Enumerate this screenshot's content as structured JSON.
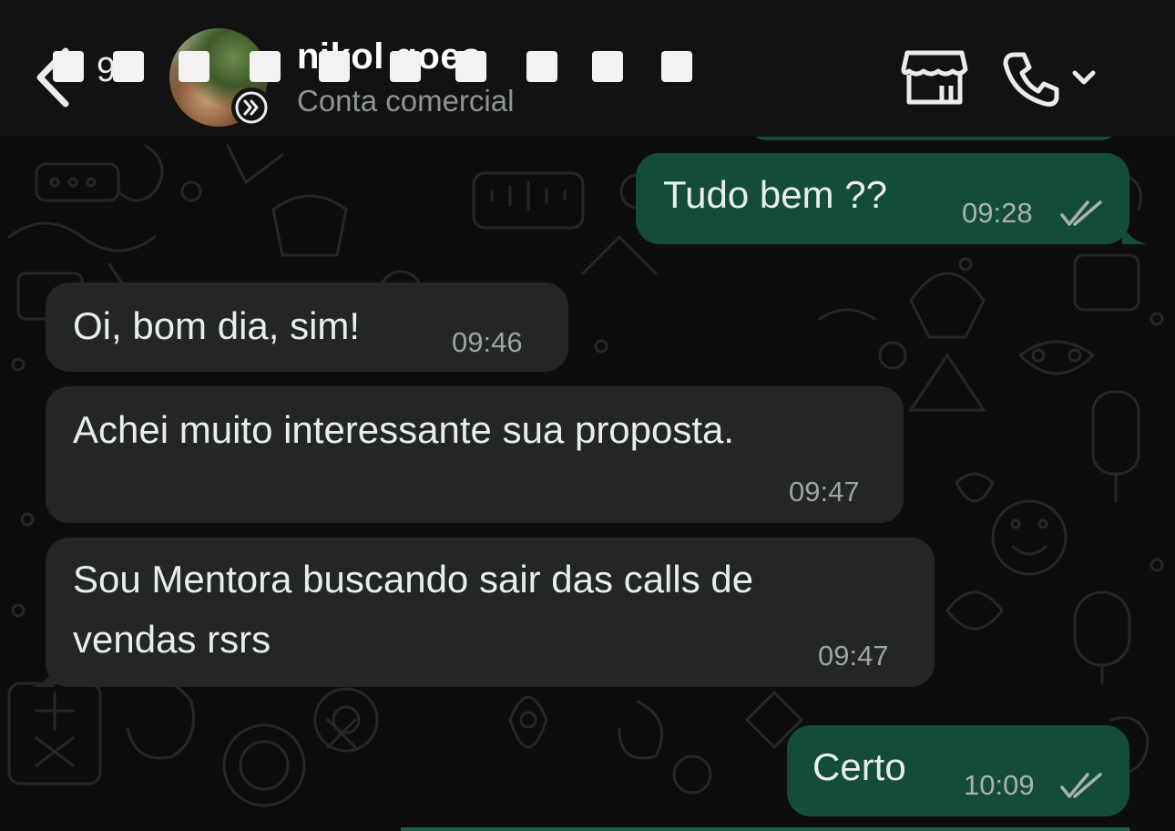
{
  "header": {
    "unread_count": "9",
    "contact_name": "nikol goes",
    "subtitle": "Conta comercial"
  },
  "icons": {
    "back": "chevron-left-icon",
    "avatar_badge": "double-chevron-right-icon",
    "store": "storefront-icon",
    "call": "phone-icon",
    "call_menu": "chevron-down-icon",
    "read_receipt": "double-check-icon"
  },
  "colors": {
    "header_bg": "#121212",
    "chat_bg": "#0c0d0c",
    "outgoing_bubble": "#144d37",
    "incoming_bubble": "#242626",
    "timestamp": "#a9b2b0"
  },
  "messages": [
    {
      "direction": "out",
      "text": "Tudo bem ??",
      "time": "09:28",
      "status": "read"
    },
    {
      "direction": "in",
      "text": "Oi, bom dia, sim!",
      "time": "09:46"
    },
    {
      "direction": "in",
      "text": "Achei muito interessante sua proposta.",
      "time": "09:47"
    },
    {
      "direction": "in",
      "line1": "Sou Mentora buscando sair das calls de",
      "line2": "vendas rsrs",
      "time": "09:47"
    },
    {
      "direction": "out",
      "text": "Certo",
      "time": "10:09",
      "status": "read"
    }
  ]
}
